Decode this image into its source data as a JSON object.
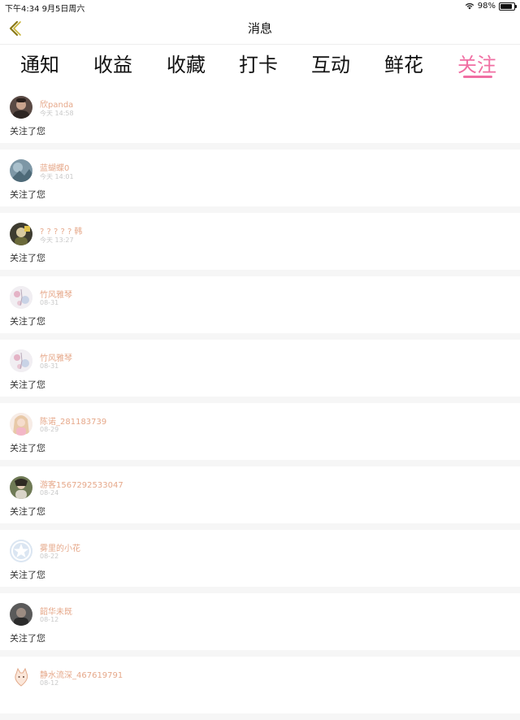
{
  "status_bar": {
    "time_date": "下午4:34   9月5日周六",
    "battery_percent": "98%",
    "battery_level": 0.98,
    "icons": [
      "wifi-icon",
      "battery-icon"
    ]
  },
  "nav": {
    "title": "消息",
    "back_icon": "chevron-left-icon"
  },
  "tabs": [
    {
      "label": "通知",
      "active": false
    },
    {
      "label": "收益",
      "active": false
    },
    {
      "label": "收藏",
      "active": false
    },
    {
      "label": "打卡",
      "active": false
    },
    {
      "label": "互动",
      "active": false
    },
    {
      "label": "鲜花",
      "active": false
    },
    {
      "label": "关注",
      "active": true
    }
  ],
  "colors": {
    "accent": "#f06fa3",
    "username": "#e6a88a",
    "timestamp": "#c9c9c9",
    "separator": "#f6f6f6"
  },
  "feed": [
    {
      "name": "欣panda",
      "time": "今天 14:58",
      "action": "关注了您",
      "avatar": "dark"
    },
    {
      "name": "蓝蝴蝶0",
      "time": "今天 14:01",
      "action": "关注了您",
      "avatar": "sky"
    },
    {
      "name": "? ? ? ? ?  韩",
      "time": "今天 13:27",
      "action": "关注了您",
      "avatar": "photo"
    },
    {
      "name": "竹风雅琴",
      "time": "08-31",
      "action": "关注了您",
      "avatar": "floral"
    },
    {
      "name": "竹风雅琴",
      "time": "08-31",
      "action": "关注了您",
      "avatar": "floral"
    },
    {
      "name": "陈诺_281183739",
      "time": "08-29",
      "action": "关注了您",
      "avatar": "girl"
    },
    {
      "name": "游客1567292533047",
      "time": "08-24",
      "action": "关注了您",
      "avatar": "photo2"
    },
    {
      "name": "雾里的小花",
      "time": "08-22",
      "action": "关注了您",
      "avatar": "default"
    },
    {
      "name": "韶华未既",
      "time": "08-12",
      "action": "关注了您",
      "avatar": "dark2"
    },
    {
      "name": "静水流深_467619791",
      "time": "08-12",
      "action": "",
      "avatar": "cat"
    }
  ]
}
